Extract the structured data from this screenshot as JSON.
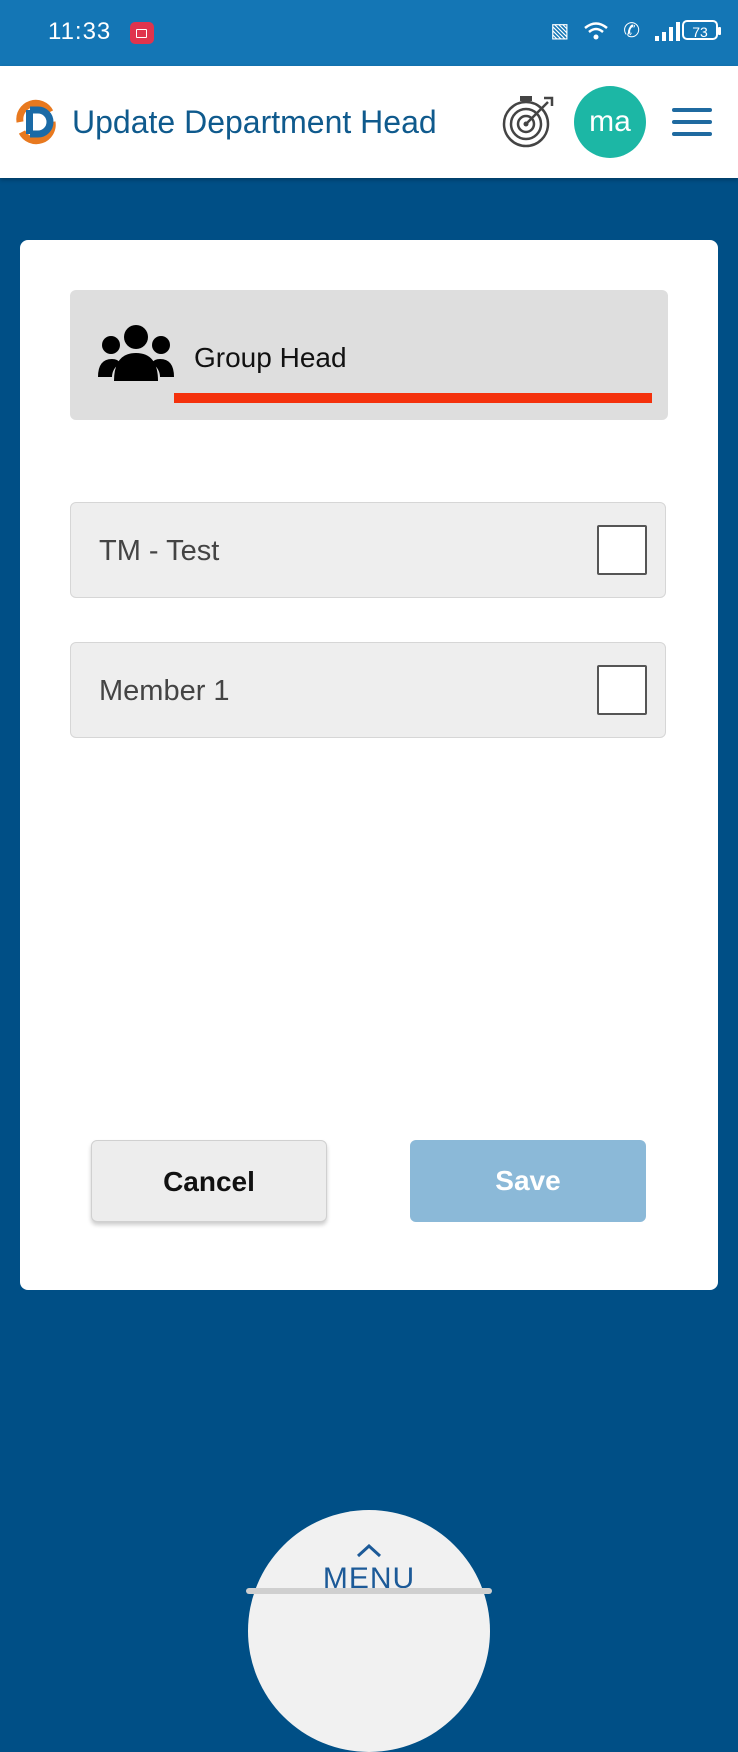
{
  "status_bar": {
    "time": "11:33",
    "battery": "73"
  },
  "header": {
    "title": "Update Department Head",
    "avatar_initials": "ma",
    "brand_color": "#0f5a8d",
    "avatar_color": "#1cb7a5"
  },
  "group_head": {
    "label": "Group Head",
    "icon": "users-group-icon",
    "underline_color": "#f4310c"
  },
  "members": [
    {
      "label": "TM - Test",
      "checked": false
    },
    {
      "label": "Member 1",
      "checked": false
    }
  ],
  "actions": {
    "cancel_label": "Cancel",
    "save_label": "Save"
  },
  "bottom_menu": {
    "label": "MENU"
  },
  "colors": {
    "background": "#004f86",
    "save_button": "#8bb9d8"
  }
}
